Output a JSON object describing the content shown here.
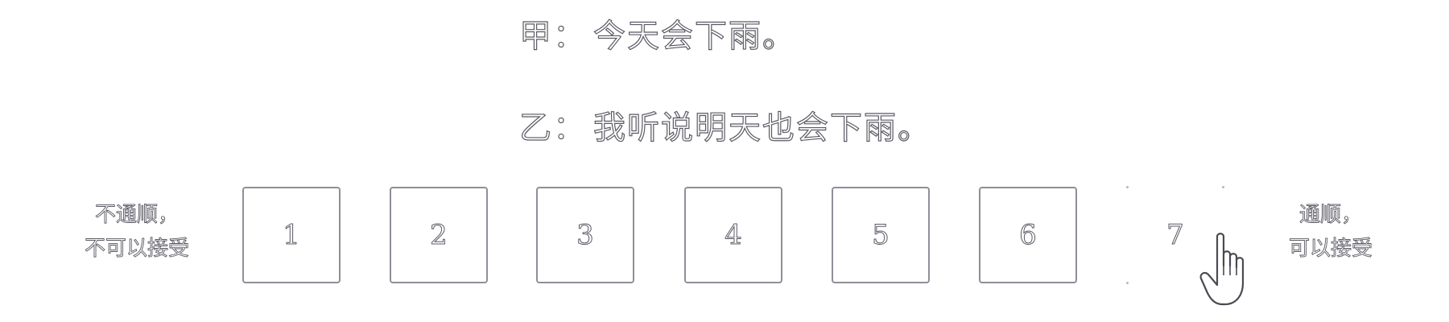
{
  "dialog": {
    "line_a": {
      "speaker": "甲：",
      "text": "今天会下雨。"
    },
    "line_b": {
      "speaker": "乙：",
      "text": "我听说明天也会下雨。"
    }
  },
  "scale": {
    "left_label_1": "不通顺，",
    "left_label_2": "不可以接受",
    "right_label_1": "通顺，",
    "right_label_2": "可以接受",
    "options": [
      "1",
      "2",
      "3",
      "4",
      "5",
      "6",
      "7"
    ],
    "hovered_option": "7"
  },
  "colors": {
    "text_outline": "#5a5a64",
    "box_border": "#8f8f99",
    "background": "#ffffff"
  },
  "icons": {
    "cursor": "hand-pointer-icon"
  }
}
